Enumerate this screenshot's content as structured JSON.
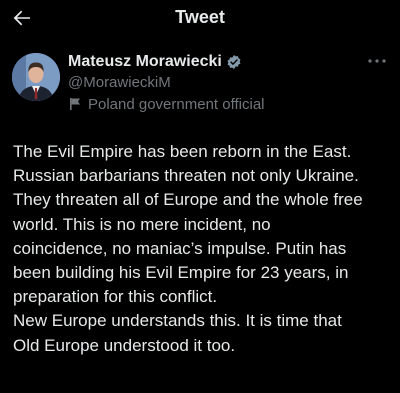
{
  "topbar": {
    "title": "Tweet",
    "back_icon": "back-arrow-icon"
  },
  "author": {
    "display_name": "Mateusz Morawiecki",
    "handle": "@MorawieckiM",
    "label": "Poland government official",
    "verified_icon": "verified-badge-icon",
    "label_icon": "flag-icon",
    "more_icon": "more-options-icon"
  },
  "tweet": {
    "lines": [
      "The Evil Empire has been reborn in the East.",
      "Russian barbarians threaten not only Ukraine.",
      "They threaten all of Europe and the whole free",
      "world. This is no mere incident, no",
      "coincidence, no maniac’s impulse. Putin has",
      "been building his Evil Empire for 23 years, in",
      "preparation for this conflict.",
      "New Europe understands this. It is time that",
      "Old Europe understood it too."
    ]
  },
  "colors": {
    "background": "#000000",
    "text": "#e7e9ea",
    "secondary": "#71767b",
    "badge": "#829aab"
  }
}
